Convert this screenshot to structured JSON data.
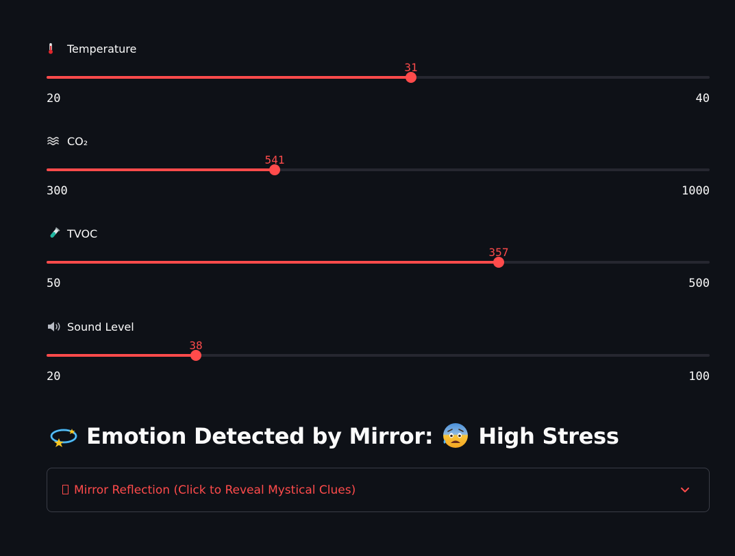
{
  "sliders": [
    {
      "label": "Temperature",
      "icon": "thermometer-icon",
      "value": 31,
      "value_text": "31",
      "min": 20,
      "max": 40,
      "min_text": "20",
      "max_text": "40"
    },
    {
      "label": "CO₂",
      "icon": "wavy-lines-icon",
      "value": 541,
      "value_text": "541",
      "min": 300,
      "max": 1000,
      "min_text": "300",
      "max_text": "1000"
    },
    {
      "label": "TVOC",
      "icon": "test-tube-icon",
      "value": 357,
      "value_text": "357",
      "min": 50,
      "max": 500,
      "min_text": "50",
      "max_text": "500"
    },
    {
      "label": "Sound Level",
      "icon": "speaker-icon",
      "value": 38,
      "value_text": "38",
      "min": 20,
      "max": 100,
      "min_text": "20",
      "max_text": "100"
    }
  ],
  "emotion": {
    "icon": "dizzy-star-icon",
    "prefix": "Emotion Detected by Mirror:",
    "state_icon": "anxious-sweat-face-icon",
    "state": "High Stress"
  },
  "expander": {
    "label": "Mirror Reflection (Click to Reveal Mystical Clues)",
    "icon": "chevron-down-icon"
  },
  "colors": {
    "accent": "#ff4b4b",
    "background": "#0e1117",
    "track": "#262730",
    "text": "#fafafa",
    "border": "#3a3d47"
  }
}
